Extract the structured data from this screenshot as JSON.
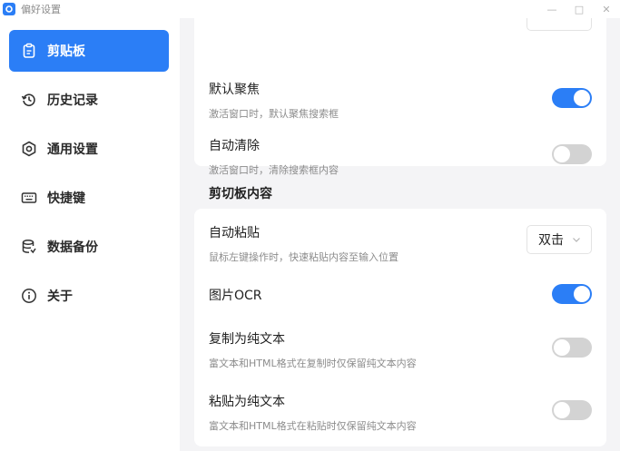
{
  "window": {
    "title": "偏好设置"
  },
  "sidebar": {
    "items": [
      {
        "label": "剪贴板",
        "icon": "clipboard-icon",
        "active": true
      },
      {
        "label": "历史记录",
        "icon": "history-icon",
        "active": false
      },
      {
        "label": "通用设置",
        "icon": "settings-icon",
        "active": false
      },
      {
        "label": "快捷键",
        "icon": "keyboard-icon",
        "active": false
      },
      {
        "label": "数据备份",
        "icon": "database-icon",
        "active": false
      },
      {
        "label": "关于",
        "icon": "info-icon",
        "active": false
      }
    ]
  },
  "clipboard_settings": {
    "default_focus": {
      "title": "默认聚焦",
      "desc": "激活窗口时，默认聚焦搜索框",
      "enabled": true
    },
    "auto_clear": {
      "title": "自动清除",
      "desc": "激活窗口时，清除搜索框内容",
      "enabled": false
    }
  },
  "content_section": {
    "title": "剪切板内容",
    "auto_paste": {
      "title": "自动粘贴",
      "desc": "鼠标左键操作时，快速粘贴内容至输入位置",
      "value": "双击"
    },
    "image_ocr": {
      "title": "图片OCR",
      "enabled": true
    },
    "copy_plain": {
      "title": "复制为纯文本",
      "desc": "富文本和HTML格式在复制时仅保留纯文本内容",
      "enabled": false
    },
    "paste_plain": {
      "title": "粘贴为纯文本",
      "desc": "富文本和HTML格式在粘贴时仅保留纯文本内容",
      "enabled": false
    }
  },
  "colors": {
    "accent": "#2b7ef6",
    "toggle_off": "#d3d3d3",
    "background": "#f4f4f6"
  }
}
